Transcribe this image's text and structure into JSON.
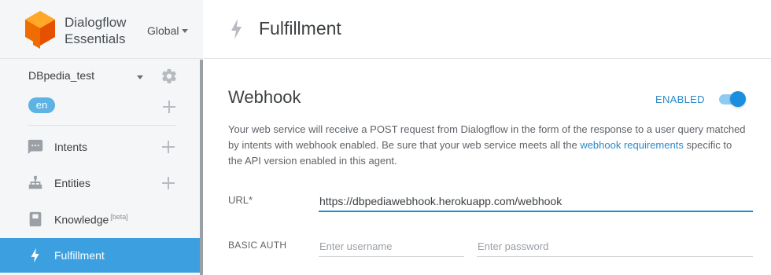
{
  "brand": {
    "name_line1": "Dialogflow",
    "name_line2": "Essentials",
    "region": "Global",
    "logo_color": "#f57c00"
  },
  "agent": {
    "name": "DBpedia_test",
    "language": "en"
  },
  "nav": {
    "intents": "Intents",
    "entities": "Entities",
    "knowledge": "Knowledge",
    "knowledge_badge": "[beta]",
    "fulfillment": "Fulfillment"
  },
  "header": {
    "title": "Fulfillment"
  },
  "webhook": {
    "title": "Webhook",
    "status": "ENABLED",
    "enabled": true,
    "desc_part1": "Your web service will receive a POST request from Dialogflow in the form of the response to a user query matched by intents with webhook enabled. Be sure that your web service meets all the ",
    "desc_link": "webhook requirements",
    "desc_part2": " specific to the API version enabled in this agent.",
    "url_label": "URL*",
    "url_value": "https://dbpediawebhook.herokuapp.com/webhook",
    "auth_label": "BASIC AUTH",
    "username_placeholder": "Enter username",
    "password_placeholder": "Enter password"
  },
  "colors": {
    "accent": "#3ca0e0",
    "link": "#2a89c9"
  }
}
